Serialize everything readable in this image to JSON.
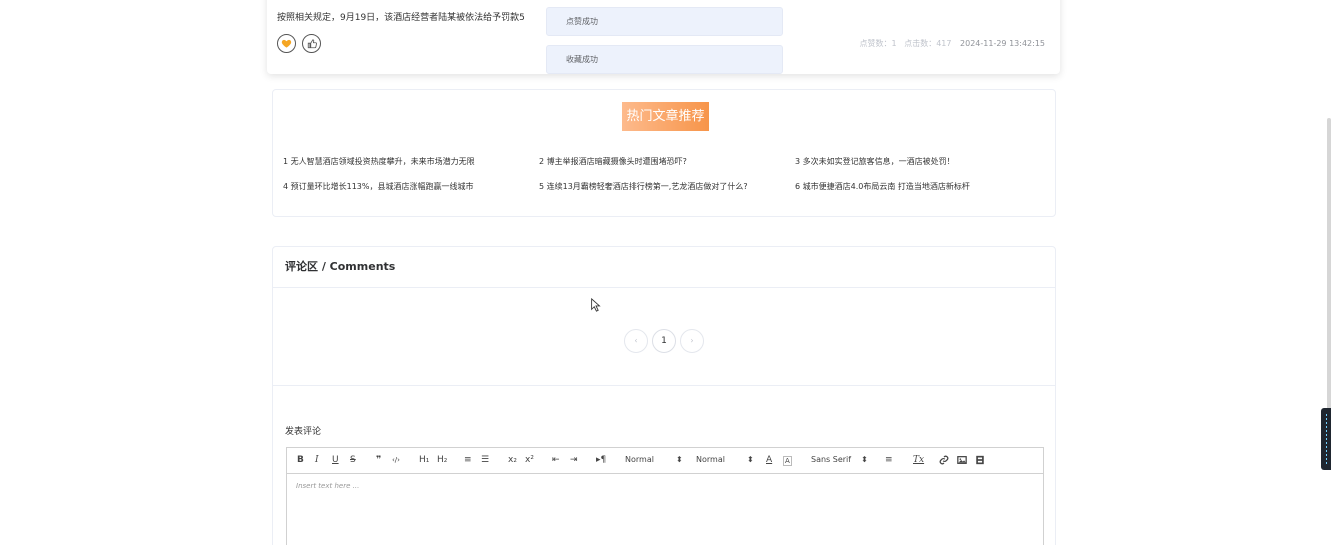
{
  "article": {
    "text": "按照相关规定，9月19日，该酒店经营者陆某被依法给予罚款5",
    "likes": "点赞数：1",
    "clicks": "点击数：417",
    "datetime": "2024-11-29 13:42:15"
  },
  "toasts": {
    "like_success": "点赞成功",
    "favorite_success": "收藏成功"
  },
  "hot": {
    "title": "热门文章推荐",
    "items": [
      "1  无人智慧酒店领域投资热度攀升，未来市场潜力无限",
      "2  博主举报酒店暗藏摄像头时遭围堵恐吓?",
      "3  多次未如实登记旅客信息，一酒店被处罚！",
      "4  预订量环比增长113%，县城酒店涨幅跑赢一线城市",
      "5  连续13月霸榜轻奢酒店排行榜第一,艺龙酒店做对了什么?",
      "6  城市便捷酒店4.0布局云南 打造当地酒店新标杆"
    ]
  },
  "comments": {
    "title": "评论区 / Comments",
    "page_prev": "‹",
    "page_current": "1",
    "page_next": "›",
    "post_label": "发表评论"
  },
  "editor": {
    "toolbar": {
      "bold": "B",
      "italic": "I",
      "underline": "U",
      "strike": "S",
      "blockquote": "❞",
      "code": "‹/›",
      "h1": "H₁",
      "h2": "H₂",
      "ordered_list": "≡",
      "bullet_list": "☰",
      "subscript": "x₂",
      "superscript": "x²",
      "outdent": "⇤",
      "indent": "⇥",
      "direction": "▸¶",
      "size_picker": "Normal",
      "header_picker": "Normal",
      "font_picker": "Sans Serif",
      "align": "≡",
      "clean": "Tx"
    },
    "placeholder": "Insert text here ..."
  }
}
